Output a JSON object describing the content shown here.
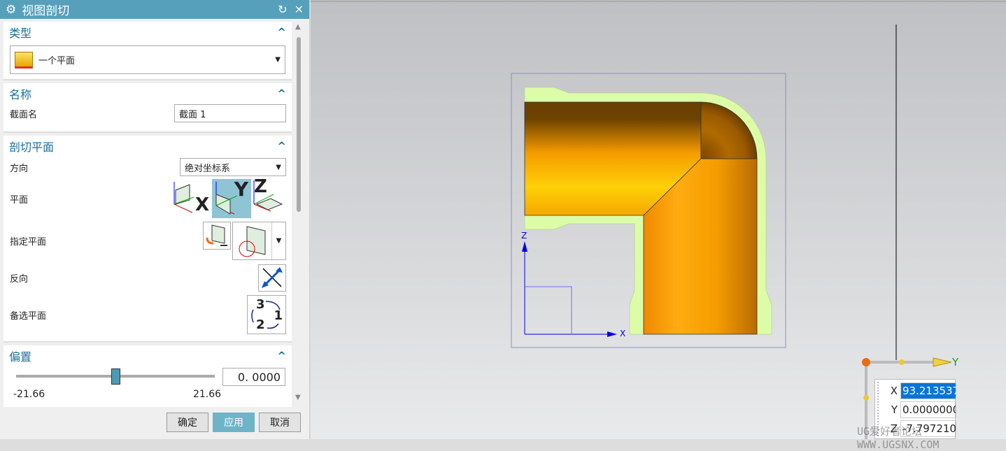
{
  "dialog": {
    "title": "视图剖切",
    "reset_icon": "reset-icon",
    "close_icon": "close-icon",
    "type_section": {
      "title": "类型",
      "value": "一个平面"
    },
    "name_section": {
      "title": "名称",
      "label": "截面名",
      "value": "截面 1"
    },
    "plane_section": {
      "title": "剖切平面",
      "direction_label": "方向",
      "direction_value": "绝对坐标系",
      "plane_label": "平面",
      "plane_x": "X",
      "plane_y": "Y",
      "plane_z": "Z",
      "specify_label": "指定平面",
      "reverse_label": "反向",
      "alternate_label": "备选平面",
      "alt_n3": "3",
      "alt_n1": "1",
      "alt_n2": "2"
    },
    "offset_section": {
      "title": "偏置",
      "value": "0. 0000",
      "min": "-21.66",
      "max": "21.66",
      "slider_fraction": 0.5
    },
    "buttons": {
      "ok": "确定",
      "apply": "应用",
      "cancel": "取消"
    }
  },
  "viewport": {
    "axis_x": "X",
    "axis_z": "Z",
    "triad_y": "Y",
    "coords": {
      "x_label": "X",
      "x_value": "93.213537",
      "y_label": "Y",
      "y_value": "0.0000000",
      "z_label": "Z",
      "z_value": "-7.797210"
    },
    "watermark": "UG爱好者论坛 WWW.UGSNX.COM",
    "colors": {
      "section_fill": "#dcfca8",
      "pipe": "#f5a300",
      "accent": "#56a0bb"
    }
  }
}
